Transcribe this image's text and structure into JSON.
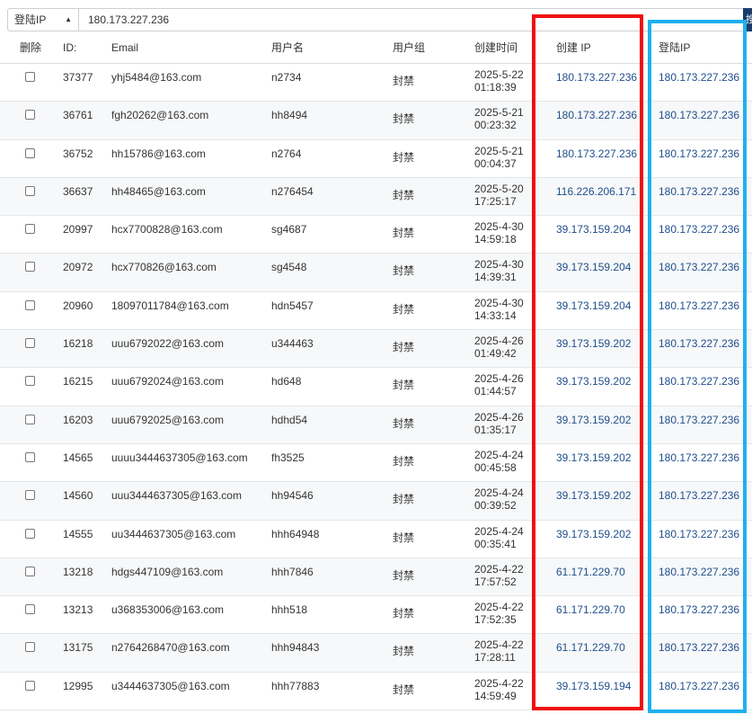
{
  "search": {
    "field": "登陆IP",
    "value": "180.173.227.236",
    "button_label": "搜"
  },
  "columns": {
    "delete": "删除",
    "id": "ID:",
    "email": "Email",
    "username": "用户名",
    "group": "用户组",
    "created": "创建时间",
    "create_ip": "创建 IP",
    "login_ip": "登陆IP"
  },
  "rows": [
    {
      "id": "37377",
      "email": "yhj5484@163.com",
      "username": "n2734",
      "group": "封禁",
      "date": "2025-5-22",
      "time": "01:18:39",
      "create_ip": "180.173.227.236",
      "login_ip": "180.173.227.236"
    },
    {
      "id": "36761",
      "email": "fgh20262@163.com",
      "username": "hh8494",
      "group": "封禁",
      "date": "2025-5-21",
      "time": "00:23:32",
      "create_ip": "180.173.227.236",
      "login_ip": "180.173.227.236"
    },
    {
      "id": "36752",
      "email": "hh15786@163.com",
      "username": "n2764",
      "group": "封禁",
      "date": "2025-5-21",
      "time": "00:04:37",
      "create_ip": "180.173.227.236",
      "login_ip": "180.173.227.236"
    },
    {
      "id": "36637",
      "email": "hh48465@163.com",
      "username": "n276454",
      "group": "封禁",
      "date": "2025-5-20",
      "time": "17:25:17",
      "create_ip": "116.226.206.171",
      "login_ip": "180.173.227.236"
    },
    {
      "id": "20997",
      "email": "hcx7700828@163.com",
      "username": "sg4687",
      "group": "封禁",
      "date": "2025-4-30",
      "time": "14:59:18",
      "create_ip": "39.173.159.204",
      "login_ip": "180.173.227.236"
    },
    {
      "id": "20972",
      "email": "hcx770826@163.com",
      "username": "sg4548",
      "group": "封禁",
      "date": "2025-4-30",
      "time": "14:39:31",
      "create_ip": "39.173.159.204",
      "login_ip": "180.173.227.236"
    },
    {
      "id": "20960",
      "email": "18097011784@163.com",
      "username": "hdn5457",
      "group": "封禁",
      "date": "2025-4-30",
      "time": "14:33:14",
      "create_ip": "39.173.159.204",
      "login_ip": "180.173.227.236"
    },
    {
      "id": "16218",
      "email": "uuu6792022@163.com",
      "username": "u344463",
      "group": "封禁",
      "date": "2025-4-26",
      "time": "01:49:42",
      "create_ip": "39.173.159.202",
      "login_ip": "180.173.227.236"
    },
    {
      "id": "16215",
      "email": "uuu6792024@163.com",
      "username": "hd648",
      "group": "封禁",
      "date": "2025-4-26",
      "time": "01:44:57",
      "create_ip": "39.173.159.202",
      "login_ip": "180.173.227.236"
    },
    {
      "id": "16203",
      "email": "uuu6792025@163.com",
      "username": "hdhd54",
      "group": "封禁",
      "date": "2025-4-26",
      "time": "01:35:17",
      "create_ip": "39.173.159.202",
      "login_ip": "180.173.227.236"
    },
    {
      "id": "14565",
      "email": "uuuu3444637305@163.com",
      "username": "fh3525",
      "group": "封禁",
      "date": "2025-4-24",
      "time": "00:45:58",
      "create_ip": "39.173.159.202",
      "login_ip": "180.173.227.236"
    },
    {
      "id": "14560",
      "email": "uuu3444637305@163.com",
      "username": "hh94546",
      "group": "封禁",
      "date": "2025-4-24",
      "time": "00:39:52",
      "create_ip": "39.173.159.202",
      "login_ip": "180.173.227.236"
    },
    {
      "id": "14555",
      "email": "uu3444637305@163.com",
      "username": "hhh64948",
      "group": "封禁",
      "date": "2025-4-24",
      "time": "00:35:41",
      "create_ip": "39.173.159.202",
      "login_ip": "180.173.227.236"
    },
    {
      "id": "13218",
      "email": "hdgs447109@163.com",
      "username": "hhh7846",
      "group": "封禁",
      "date": "2025-4-22",
      "time": "17:57:52",
      "create_ip": "61.171.229.70",
      "login_ip": "180.173.227.236"
    },
    {
      "id": "13213",
      "email": "u368353006@163.com",
      "username": "hhh518",
      "group": "封禁",
      "date": "2025-4-22",
      "time": "17:52:35",
      "create_ip": "61.171.229.70",
      "login_ip": "180.173.227.236"
    },
    {
      "id": "13175",
      "email": "n2764268470@163.com",
      "username": "hhh94843",
      "group": "封禁",
      "date": "2025-4-22",
      "time": "17:28:11",
      "create_ip": "61.171.229.70",
      "login_ip": "180.173.227.236"
    },
    {
      "id": "12995",
      "email": "u3444637305@163.com",
      "username": "hhh77883",
      "group": "封禁",
      "date": "2025-4-22",
      "time": "14:59:49",
      "create_ip": "39.173.159.194",
      "login_ip": "180.173.227.236"
    }
  ]
}
